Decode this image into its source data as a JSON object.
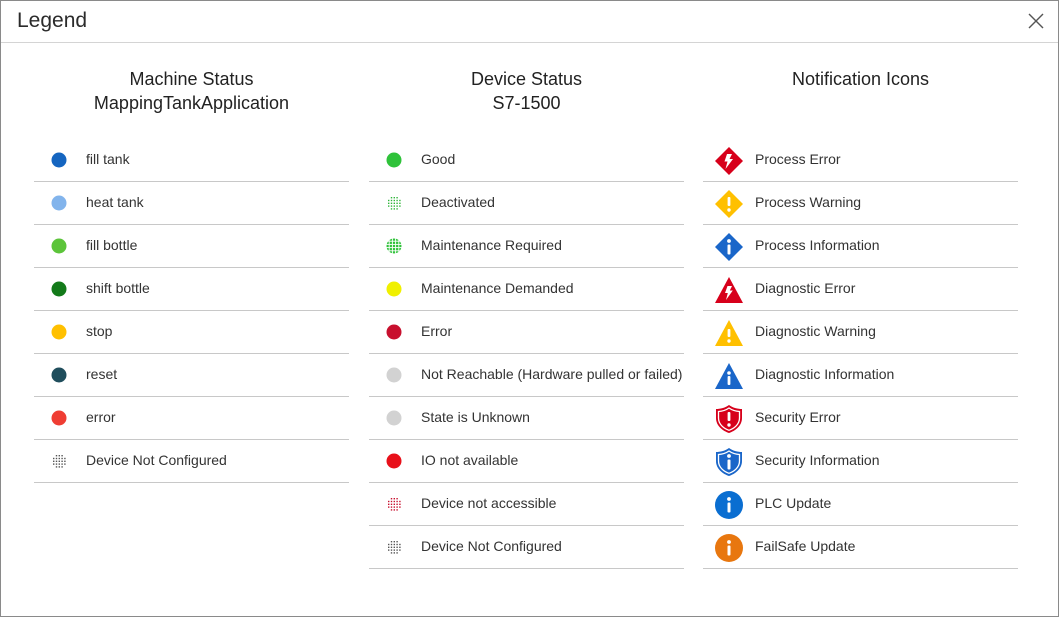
{
  "dialog": {
    "title": "Legend"
  },
  "machine": {
    "heading1": "Machine Status",
    "heading2": "MappingTankApplication",
    "items": [
      {
        "label": "fill tank",
        "color": "#1565c0",
        "icon": "filled-dot"
      },
      {
        "label": "heat tank",
        "color": "#82b4ec",
        "icon": "filled-dot"
      },
      {
        "label": "fill bottle",
        "color": "#5cc43a",
        "icon": "filled-dot"
      },
      {
        "label": "shift bottle",
        "color": "#137a1a",
        "icon": "filled-dot"
      },
      {
        "label": "stop",
        "color": "#ffc000",
        "icon": "filled-dot"
      },
      {
        "label": "reset",
        "color": "#1f4d5c",
        "icon": "filled-dot"
      },
      {
        "label": "error",
        "color": "#ef3d33",
        "icon": "filled-dot"
      },
      {
        "label": "Device Not Configured",
        "color": "#555555",
        "icon": "dotted-grid"
      }
    ]
  },
  "device": {
    "heading1": "Device Status",
    "heading2": "S7-1500",
    "items": [
      {
        "label": "Good",
        "color": "#2fc23a",
        "icon": "filled-dot"
      },
      {
        "label": "Deactivated",
        "color": "#2fb53a",
        "icon": "dotted-grid"
      },
      {
        "label": "Maintenance Required",
        "color": "#2fc23a",
        "icon": "grid-dot"
      },
      {
        "label": "Maintenance Demanded",
        "color": "#f0f000",
        "icon": "filled-dot"
      },
      {
        "label": "Error",
        "color": "#c8102e",
        "icon": "filled-dot"
      },
      {
        "label": "Not Reachable (Hardware pulled or failed)",
        "color": "#d2d2d2",
        "icon": "filled-dot"
      },
      {
        "label": "State is Unknown",
        "color": "#d2d2d2",
        "icon": "filled-dot"
      },
      {
        "label": "IO not available",
        "color": "#e8101a",
        "icon": "filled-dot"
      },
      {
        "label": "Device not accessible",
        "color": "#c8102e",
        "icon": "dotted-grid"
      },
      {
        "label": "Device Not Configured",
        "color": "#555555",
        "icon": "dotted-grid"
      }
    ]
  },
  "notifications": {
    "heading1": "Notification Icons",
    "items": [
      {
        "label": "Process Error",
        "icon": "process-error-icon",
        "color": "#d7001b"
      },
      {
        "label": "Process Warning",
        "icon": "process-warning-icon",
        "color": "#ffc000"
      },
      {
        "label": "Process Information",
        "icon": "process-information-icon",
        "color": "#1a66c9"
      },
      {
        "label": "Diagnostic Error",
        "icon": "diagnostic-error-icon",
        "color": "#d7001b"
      },
      {
        "label": "Diagnostic Warning",
        "icon": "diagnostic-warning-icon",
        "color": "#ffc000"
      },
      {
        "label": "Diagnostic Information",
        "icon": "diagnostic-information-icon",
        "color": "#1a66c9"
      },
      {
        "label": "Security Error",
        "icon": "security-error-icon",
        "color": "#d7001b"
      },
      {
        "label": "Security Information",
        "icon": "security-information-icon",
        "color": "#1a66c9"
      },
      {
        "label": "PLC Update",
        "icon": "plc-update-icon",
        "color": "#0a6ed1"
      },
      {
        "label": "FailSafe Update",
        "icon": "failsafe-update-icon",
        "color": "#e8770f"
      }
    ]
  }
}
